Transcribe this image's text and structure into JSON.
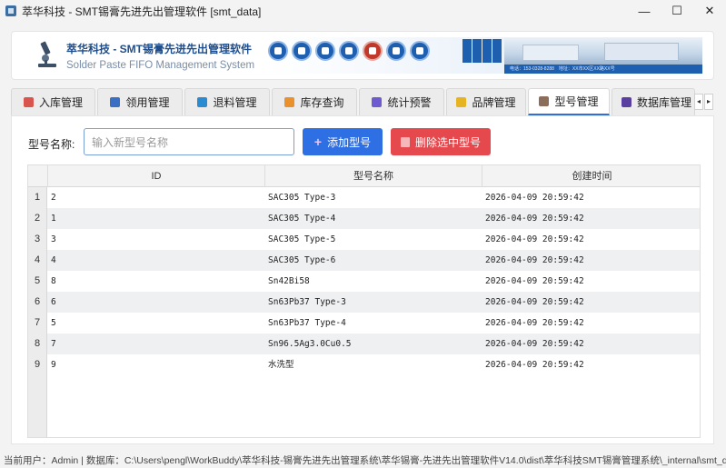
{
  "window": {
    "title": "萃华科技 - SMT锡膏先进先出管理软件 [smt_data]",
    "controls": [
      "—",
      "☐",
      "✕"
    ]
  },
  "header": {
    "brand_cn": "萃华科技 - SMT锡膏先进先出管理软件",
    "brand_en": "Solder Paste FIFO Management System",
    "banner_text": "电话：153-0328-8288　地址：XX市XX区XX路XX号"
  },
  "tabs": [
    {
      "label": "入库管理",
      "color": "#d9534f",
      "active": false
    },
    {
      "label": "领用管理",
      "color": "#3a6fc4",
      "active": false
    },
    {
      "label": "退料管理",
      "color": "#2a8bd0",
      "active": false
    },
    {
      "label": "库存查询",
      "color": "#e8912d",
      "active": false
    },
    {
      "label": "统计预警",
      "color": "#6c5ccf",
      "active": false
    },
    {
      "label": "品牌管理",
      "color": "#e6b422",
      "active": false
    },
    {
      "label": "型号管理",
      "color": "#8a6d5a",
      "active": true
    },
    {
      "label": "数据库管理",
      "color": "#5a3fa0",
      "active": false
    }
  ],
  "form": {
    "label": "型号名称:",
    "input_placeholder": "输入新型号名称",
    "input_value": "",
    "add_button": "添加型号",
    "delete_button": "删除选中型号"
  },
  "table": {
    "columns": [
      "ID",
      "型号名称",
      "创建时间"
    ],
    "rows": [
      {
        "num": "1",
        "id": "2",
        "name": "SAC305 Type-3",
        "time": "2026-04-09 20:59:42"
      },
      {
        "num": "2",
        "id": "1",
        "name": "SAC305 Type-4",
        "time": "2026-04-09 20:59:42"
      },
      {
        "num": "3",
        "id": "3",
        "name": "SAC305 Type-5",
        "time": "2026-04-09 20:59:42"
      },
      {
        "num": "4",
        "id": "4",
        "name": "SAC305 Type-6",
        "time": "2026-04-09 20:59:42"
      },
      {
        "num": "5",
        "id": "8",
        "name": "Sn42Bi58",
        "time": "2026-04-09 20:59:42"
      },
      {
        "num": "6",
        "id": "6",
        "name": "Sn63Pb37 Type-3",
        "time": "2026-04-09 20:59:42"
      },
      {
        "num": "7",
        "id": "5",
        "name": "Sn63Pb37 Type-4",
        "time": "2026-04-09 20:59:42"
      },
      {
        "num": "8",
        "id": "7",
        "name": "Sn96.5Ag3.0Cu0.5",
        "time": "2026-04-09 20:59:42"
      },
      {
        "num": "9",
        "id": "9",
        "name": "水洗型",
        "time": "2026-04-09 20:59:42"
      }
    ]
  },
  "status": {
    "text": "当前用户：Admin | 数据库：C:\\Users\\pengl\\WorkBuddy\\萃华科技-锡膏先进先出管理系统\\萃华锡膏-先进先出管理软件V14.0\\dist\\萃华科技SMT锡膏管理系统\\_internal\\smt_data.db"
  }
}
